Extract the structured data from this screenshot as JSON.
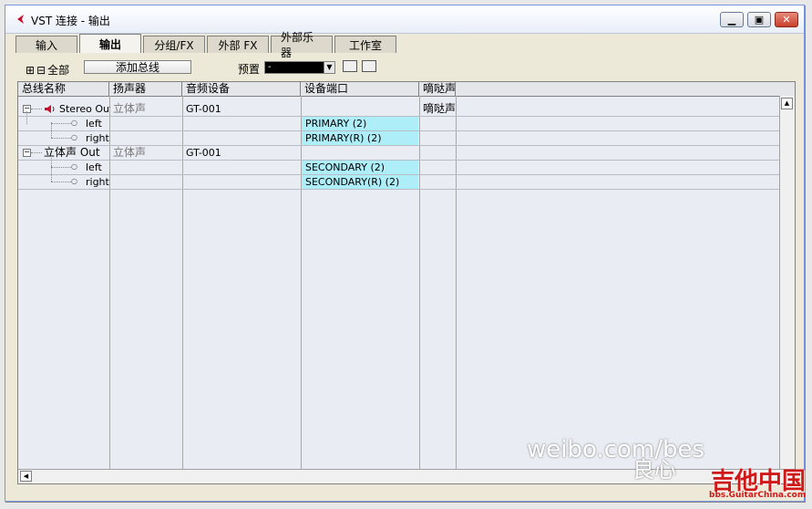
{
  "window": {
    "title": "VST 连接 - 输出"
  },
  "tabs": [
    {
      "label": "输入",
      "active": false
    },
    {
      "label": "输出",
      "active": true
    },
    {
      "label": "分组/FX",
      "active": false
    },
    {
      "label": "外部 FX",
      "active": false
    },
    {
      "label": "外部乐器",
      "active": false
    },
    {
      "label": "工作室",
      "active": false
    }
  ],
  "toolbar": {
    "expand_all_label": "全部",
    "add_bus_label": "添加总线",
    "preset_label": "预置",
    "preset_value": "-"
  },
  "columns": [
    "总线名称",
    "扬声器",
    "音频设备",
    "设备端口",
    "嘀哒声"
  ],
  "rows": [
    {
      "name": "Stereo Out",
      "speaker": "立体声",
      "device": "GT-001",
      "port": "",
      "click": "嘀哒声"
    },
    {
      "name": "left",
      "speaker": "",
      "device": "",
      "port": "PRIMARY (2)",
      "click": ""
    },
    {
      "name": "right",
      "speaker": "",
      "device": "",
      "port": "PRIMARY(R) (2)",
      "click": ""
    },
    {
      "name": "立体声 Out",
      "speaker": "立体声",
      "device": "GT-001",
      "port": "",
      "click": ""
    },
    {
      "name": "left",
      "speaker": "",
      "device": "",
      "port": "SECONDARY (2)",
      "click": ""
    },
    {
      "name": "right",
      "speaker": "",
      "device": "",
      "port": "SECONDARY(R) (2)",
      "click": ""
    }
  ],
  "watermark": {
    "text": "weibo.com/bes",
    "text2": "良心",
    "site": "吉他中国",
    "site_url": "bbs.GuitarChina.com"
  },
  "colors": {
    "port_highlight": "#aeeef8",
    "accent": "#c8102e"
  }
}
